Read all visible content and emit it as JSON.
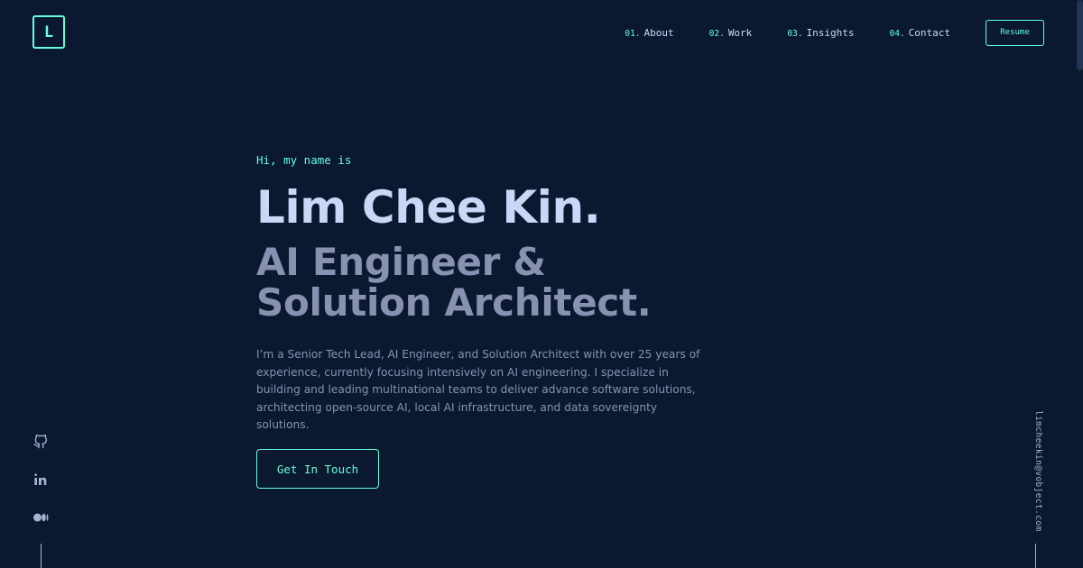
{
  "header": {
    "logo_letter": "L",
    "nav": [
      {
        "num": "01.",
        "label": "About"
      },
      {
        "num": "02.",
        "label": "Work"
      },
      {
        "num": "03.",
        "label": "Insights"
      },
      {
        "num": "04.",
        "label": "Contact"
      }
    ],
    "resume_label": "Resume"
  },
  "hero": {
    "greeting": "Hi, my name is",
    "name": "Lim Chee Kin.",
    "role": "AI Engineer & Solution Architect.",
    "bio": "I’m a Senior Tech Lead, AI Engineer, and Solution Architect with over 25 years of experience, currently focusing intensively on AI engineering. I specialize in building and leading multinational teams to deliver advance software solutions, architecting open-source AI, local AI infrastructure, and data sovereignty solutions.",
    "cta_label": "Get In Touch"
  },
  "social": {
    "icons": [
      "github-icon",
      "linkedin-icon",
      "medium-icon"
    ]
  },
  "email": "limcheekin@vobject.com",
  "colors": {
    "background": "#0a192f",
    "accent": "#64ffda",
    "heading": "#ccd6f6",
    "muted": "#8892b0"
  }
}
